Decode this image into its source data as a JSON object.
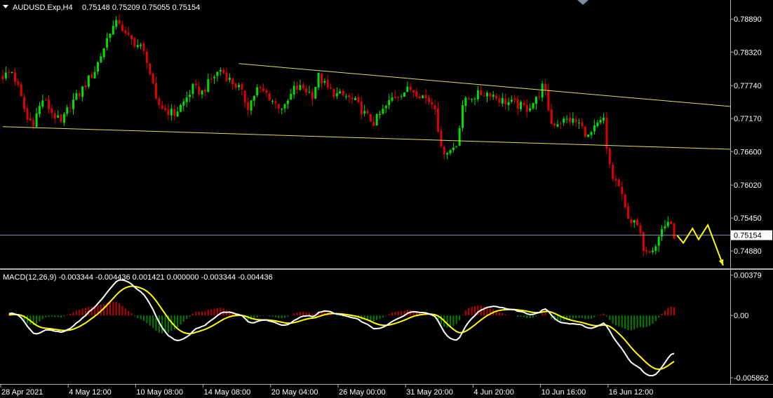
{
  "header": {
    "symbol": "AUDUSD.Exp,H4",
    "ohlc": "0.75148 0.75209 0.75055 0.75154",
    "macd_label": "MACD(12,26,9) -0.003344 -0.004436 0.001421 0.000000 -0.003344 -0.004436"
  },
  "colors": {
    "background": "#000000",
    "bull": "#00e000",
    "bear": "#e00000",
    "trendline": "#e0e060",
    "macd_line": "#ffffff",
    "signal_line": "#ffff00",
    "hist_positive": "#c00000",
    "hist_negative": "#008000",
    "axis_text": "#ffffff",
    "forecast_arrow": "#ffff00"
  },
  "chart_data": [
    {
      "type": "candlestick",
      "title": "AUDUSD.Exp,H4",
      "y_ticks": [
        "0.78890",
        "0.78320",
        "0.77740",
        "0.77170",
        "0.76600",
        "0.76020",
        "0.75450",
        "0.74880"
      ],
      "ylim": [
        0.7458,
        0.7922
      ],
      "current_price": "0.75154",
      "x_ticks": [
        "28 Apr 2021",
        "4 May 12:00",
        "10 May 08:00",
        "14 May 08:00",
        "20 May 04:00",
        "26 May 00:00",
        "31 May 20:00",
        "4 Jun 20:00",
        "10 Jun 16:00",
        "16 Jun 12:00"
      ],
      "anchors": [
        [
          0,
          0.779
        ],
        [
          3,
          0.7798
        ],
        [
          5,
          0.777
        ],
        [
          8,
          0.7715
        ],
        [
          10,
          0.7712
        ],
        [
          13,
          0.775
        ],
        [
          16,
          0.7728
        ],
        [
          19,
          0.7708
        ],
        [
          22,
          0.7742
        ],
        [
          25,
          0.776
        ],
        [
          28,
          0.7785
        ],
        [
          30,
          0.78
        ],
        [
          33,
          0.784
        ],
        [
          35,
          0.787
        ],
        [
          38,
          0.7885
        ],
        [
          40,
          0.786
        ],
        [
          42,
          0.7852
        ],
        [
          45,
          0.784
        ],
        [
          47,
          0.782
        ],
        [
          50,
          0.7745
        ],
        [
          53,
          0.7732
        ],
        [
          56,
          0.7725
        ],
        [
          59,
          0.7745
        ],
        [
          62,
          0.777
        ],
        [
          65,
          0.7762
        ],
        [
          68,
          0.7785
        ],
        [
          71,
          0.7802
        ],
        [
          74,
          0.7784
        ],
        [
          77,
          0.777
        ],
        [
          80,
          0.7738
        ],
        [
          83,
          0.7768
        ],
        [
          86,
          0.776
        ],
        [
          89,
          0.7742
        ],
        [
          92,
          0.7735
        ],
        [
          95,
          0.7768
        ],
        [
          98,
          0.777
        ],
        [
          101,
          0.7758
        ],
        [
          103,
          0.779
        ],
        [
          106,
          0.7768
        ],
        [
          109,
          0.7758
        ],
        [
          112,
          0.7755
        ],
        [
          115,
          0.7745
        ],
        [
          118,
          0.7725
        ],
        [
          121,
          0.771
        ],
        [
          124,
          0.773
        ],
        [
          127,
          0.7752
        ],
        [
          130,
          0.7762
        ],
        [
          133,
          0.7768
        ],
        [
          136,
          0.776
        ],
        [
          139,
          0.7748
        ],
        [
          141,
          0.774
        ],
        [
          143,
          0.7662
        ],
        [
          146,
          0.7662
        ],
        [
          148,
          0.7672
        ],
        [
          150,
          0.7742
        ],
        [
          153,
          0.7755
        ],
        [
          156,
          0.776
        ],
        [
          159,
          0.7762
        ],
        [
          162,
          0.775
        ],
        [
          165,
          0.7745
        ],
        [
          168,
          0.774
        ],
        [
          171,
          0.7735
        ],
        [
          174,
          0.775
        ],
        [
          176,
          0.7772
        ],
        [
          177,
          0.776
        ],
        [
          179,
          0.7708
        ],
        [
          182,
          0.7712
        ],
        [
          185,
          0.7715
        ],
        [
          188,
          0.7708
        ],
        [
          191,
          0.7685
        ],
        [
          194,
          0.7705
        ],
        [
          196,
          0.7715
        ],
        [
          197,
          0.766
        ],
        [
          199,
          0.7615
        ],
        [
          201,
          0.76
        ],
        [
          203,
          0.756
        ],
        [
          205,
          0.754
        ],
        [
          207,
          0.753
        ],
        [
          209,
          0.7495
        ],
        [
          211,
          0.7492
        ],
        [
          213,
          0.75
        ],
        [
          215,
          0.7525
        ],
        [
          217,
          0.754
        ],
        [
          219,
          0.7515
        ]
      ],
      "trendlines": [
        {
          "from": [
            0,
            0.7703
          ],
          "to": [
            "right",
            0.7664
          ]
        },
        {
          "from": [
            77,
            0.7812
          ],
          "to": [
            "right",
            0.7738
          ]
        }
      ]
    },
    {
      "type": "macd",
      "title": "MACD(12,26,9)",
      "params": [
        12,
        26,
        9
      ],
      "values": {
        "macd": -0.003344,
        "signal": -0.004436,
        "histogram": 0.001421
      },
      "y_ticks": [
        "0.00379",
        "0.00",
        "-0.005862"
      ],
      "ylim": [
        -0.00645,
        0.0043
      ]
    }
  ]
}
